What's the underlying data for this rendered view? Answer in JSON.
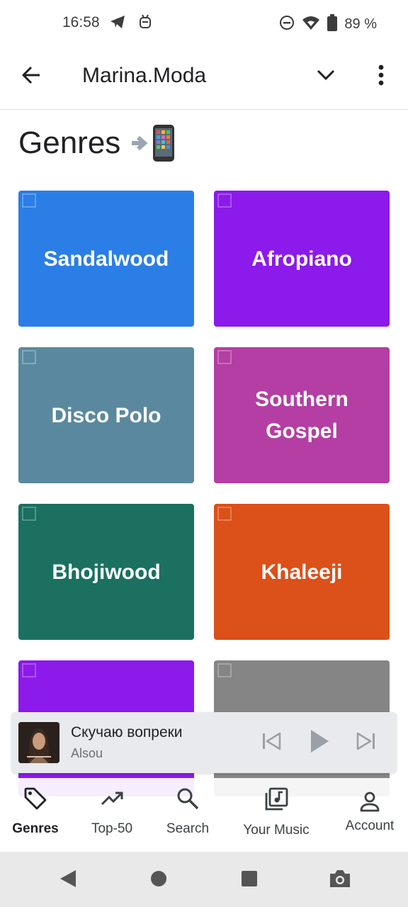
{
  "status_bar": {
    "time": "16:58",
    "battery": "89 %",
    "icons": [
      "telegram-icon",
      "robot-icon",
      "do-not-disturb-icon",
      "wifi-icon",
      "battery-icon"
    ]
  },
  "app_bar": {
    "title": "Marina.Moda",
    "icons": [
      "back-arrow-icon",
      "chevron-down-icon",
      "more-vert-icon"
    ]
  },
  "page": {
    "heading": "Genres",
    "heading_emoji": "📲"
  },
  "genres": [
    {
      "label": "Sandalwood",
      "color": "#2b7ee6"
    },
    {
      "label": "Afropiano",
      "color": "#8c1aea"
    },
    {
      "label": "Disco Polo",
      "color": "#5a899f"
    },
    {
      "label": "Southern Gospel",
      "color": "#b43ea3"
    },
    {
      "label": "Bhojiwood",
      "color": "#1b7060"
    },
    {
      "label": "Khaleeji",
      "color": "#dc5019"
    },
    {
      "label": "",
      "color": "#8c1aea"
    },
    {
      "label": "",
      "color": "#858585"
    }
  ],
  "player": {
    "title": "Скучаю вопреки",
    "artist": "Alsou",
    "icons": [
      "skip-previous-icon",
      "play-icon",
      "skip-next-icon"
    ]
  },
  "bottom_nav": [
    {
      "label": "Genres",
      "icon": "tag-icon",
      "active": true
    },
    {
      "label": "Top-50",
      "icon": "trending-up-icon",
      "active": false
    },
    {
      "label": "Search",
      "icon": "search-icon",
      "active": false
    },
    {
      "label": "Your Music",
      "icon": "library-music-icon",
      "active": false
    },
    {
      "label": "Account",
      "icon": "person-icon",
      "active": false
    }
  ],
  "system_nav": [
    "back-triangle-icon",
    "home-circle-icon",
    "recents-square-icon",
    "screenshot-camera-icon"
  ]
}
